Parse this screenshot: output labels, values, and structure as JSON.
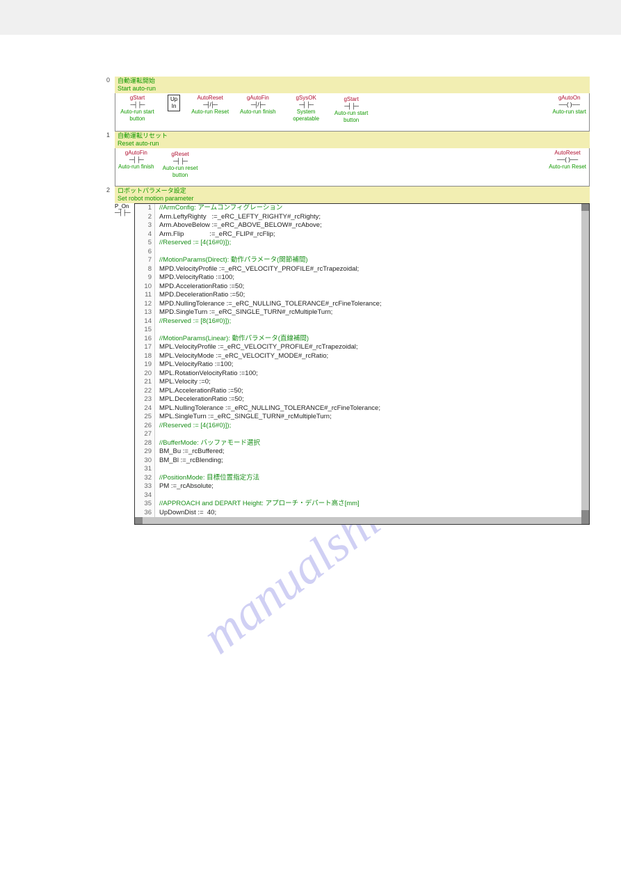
{
  "watermark_text": "manualshive.com",
  "rungs": [
    {
      "index": "0",
      "header_jp": "自動運転開始",
      "header_en": "Start auto-run",
      "left": [
        {
          "var": "gStart",
          "sym": "─┤ ├─",
          "desc": "Auto-run start button"
        },
        {
          "var": "",
          "fb": "Up\nIn",
          "desc": ""
        },
        {
          "var": "AutoReset",
          "sym": "─┤/├─",
          "desc": "Auto-run Reset"
        },
        {
          "var": "gAutoFin",
          "sym": "─┤/├─",
          "desc": "Auto-run finish"
        },
        {
          "var": "gSysOK",
          "sym": "─┤ ├─",
          "desc": "System operatable"
        }
      ],
      "branches": [
        {
          "var": "gStart",
          "sym": "─┤ ├─",
          "desc": "Auto-run start button"
        }
      ],
      "right": {
        "var": "gAutoOn",
        "sym": "──( )──",
        "desc": "Auto-run start"
      }
    },
    {
      "index": "1",
      "header_jp": "自動運転リセット",
      "header_en": "Reset auto-run",
      "left": [
        {
          "var": "gAutoFin",
          "sym": "─┤ ├─",
          "desc": "Auto-run finish"
        }
      ],
      "branches": [
        {
          "var": "gReset",
          "sym": "─┤ ├─",
          "desc": "Auto-run reset button"
        }
      ],
      "right": {
        "var": "AutoReset",
        "sym": "──( )──",
        "desc": "Auto-run Reset"
      }
    },
    {
      "index": "2",
      "header_jp": "ロボットパラメータ設定",
      "header_en": "Set robot motion parameter",
      "p_on_label": "P_On"
    }
  ],
  "code_lines": [
    {
      "n": 1,
      "t": "//ArmConfig: アームコンフィグレーション",
      "c": true
    },
    {
      "n": 2,
      "t": "Arm.LeftyRighty   :=_eRC_LEFTY_RIGHTY#_rcRighty;"
    },
    {
      "n": 3,
      "t": "Arm.AboveBelow :=_eRC_ABOVE_BELOW#_rcAbove;"
    },
    {
      "n": 4,
      "t": "Arm.Flip              :=_eRC_FLIP#_rcFlip;"
    },
    {
      "n": 5,
      "t": "//Reserved := [4(16#0)]);",
      "c": true
    },
    {
      "n": 6,
      "t": ""
    },
    {
      "n": 7,
      "t": "//MotionParams(Direct): 動作パラメータ(関節補間)",
      "c": true
    },
    {
      "n": 8,
      "t": "MPD.VelocityProfile :=_eRC_VELOCITY_PROFILE#_rcTrapezoidal;"
    },
    {
      "n": 9,
      "t": "MPD.VelocityRatio :=100;"
    },
    {
      "n": 10,
      "t": "MPD.AccelerationRatio :=50;"
    },
    {
      "n": 11,
      "t": "MPD.DecelerationRatio :=50;"
    },
    {
      "n": 12,
      "t": "MPD.NullingTolerance :=_eRC_NULLING_TOLERANCE#_rcFineTolerance;"
    },
    {
      "n": 13,
      "t": "MPD.SingleTurn :=_eRC_SINGLE_TURN#_rcMultipleTurn;"
    },
    {
      "n": 14,
      "t": "//Reserved := [8(16#0)]);",
      "c": true
    },
    {
      "n": 15,
      "t": ""
    },
    {
      "n": 16,
      "t": "//MotionParams(Linear): 動作パラメータ(直線補間)",
      "c": true
    },
    {
      "n": 17,
      "t": "MPL.VelocityProfile :=_eRC_VELOCITY_PROFILE#_rcTrapezoidal;"
    },
    {
      "n": 18,
      "t": "MPL.VelocityMode :=_eRC_VELOCITY_MODE#_rcRatio;"
    },
    {
      "n": 19,
      "t": "MPL.VelocityRatio :=100;"
    },
    {
      "n": 20,
      "t": "MPL.RotationVelocityRatio :=100;"
    },
    {
      "n": 21,
      "t": "MPL.Velocity :=0;"
    },
    {
      "n": 22,
      "t": "MPL.AccelerationRatio :=50;"
    },
    {
      "n": 23,
      "t": "MPL.DecelerationRatio :=50;"
    },
    {
      "n": 24,
      "t": "MPL.NullingTolerance :=_eRC_NULLING_TOLERANCE#_rcFineTolerance;"
    },
    {
      "n": 25,
      "t": "MPL.SingleTurn :=_eRC_SINGLE_TURN#_rcMultipleTurn;"
    },
    {
      "n": 26,
      "t": "//Reserved := [4(16#0)]);",
      "c": true
    },
    {
      "n": 27,
      "t": ""
    },
    {
      "n": 28,
      "t": "//BufferMode: バッファモード選択",
      "c": true
    },
    {
      "n": 29,
      "t": "BM_Bu :=_rcBuffered;"
    },
    {
      "n": 30,
      "t": "BM_Bl :=_rcBlending;"
    },
    {
      "n": 31,
      "t": ""
    },
    {
      "n": 32,
      "t": "//PositionMode: 目標位置指定方法",
      "c": true
    },
    {
      "n": 33,
      "t": "PM :=_rcAbsolute;"
    },
    {
      "n": 34,
      "t": ""
    },
    {
      "n": 35,
      "t": "//APPROACH and DEPART Height: アプローチ・デパート高さ[mm]",
      "c": true
    },
    {
      "n": 36,
      "t": "UpDownDist :=  40;"
    }
  ]
}
